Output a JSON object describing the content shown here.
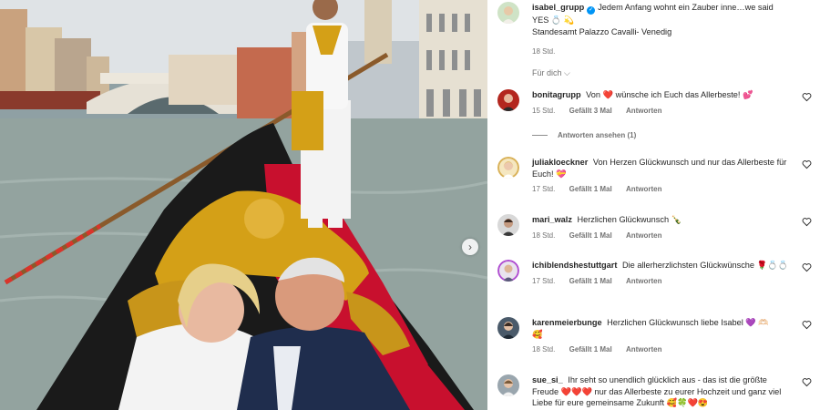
{
  "photo": {
    "alt": "Bride and groom in a gondola on the Grand Canal in Venice"
  },
  "carousel": {
    "next_icon": "chevron-right-icon"
  },
  "caption": {
    "username": "isabel_grupp",
    "verified": true,
    "text_main": "Jedem Anfang wohnt ein Zauber inne…we said YES 💍 💫",
    "text_location": "Standesamt Palazzo Cavalli- Venedig",
    "time": "18 Std."
  },
  "filter": {
    "label": "Für dich",
    "icon": "chevron-down-icon"
  },
  "comments": [
    {
      "username": "bonitagrupp",
      "text_pre": "Von",
      "heart": "❤️",
      "text_post": "wünsche ich Euch das Allerbeste! 💕",
      "time": "15 Std.",
      "likes": "Gefällt 3 Mal",
      "reply": "Antworten",
      "avatar_color": "#b3261e"
    },
    {
      "username": "juliakloeckner",
      "text": "Von Herzen Glückwunsch und nur das Allerbeste für Euch! 💝",
      "time": "17 Std.",
      "likes": "Gefällt 1 Mal",
      "reply": "Antworten",
      "avatar_color": "#d9b25a"
    },
    {
      "username": "mari_walz",
      "text": "Herzlichen Glückwunsch 🍾",
      "time": "18 Std.",
      "likes": "Gefällt 1 Mal",
      "reply": "Antworten",
      "avatar_color": "#6b6b6b"
    },
    {
      "username": "ichiblendshestuttgart",
      "text": "Die allerherzlichsten Glückwünsche 🌹💍💍",
      "time": "17 Std.",
      "likes": "Gefällt 1 Mal",
      "reply": "Antworten",
      "avatar_color": "#9a6fb0"
    },
    {
      "username": "karenmeierbunge",
      "text_pre": "Herzlichen Glückwunsch liebe Isabel 💜 🫶🏻",
      "text_post": "🥰",
      "time": "18 Std.",
      "likes": "Gefällt 1 Mal",
      "reply": "Antworten",
      "avatar_color": "#4a5a6a"
    },
    {
      "username": "sue_si_",
      "text": "Ihr seht so unendlich glücklich aus - das ist die größte Freude ❤️❤️❤️ nur das Allerbeste zu eurer Hochzeit und ganz viel Liebe für eure gemeinsame Zukunft 🥰🍀❤️😍",
      "avatar_color": "#7b8a95"
    }
  ],
  "replies": {
    "label": "Antworten ansehen (1)"
  },
  "like_icon": "heart-outline-icon",
  "colors": {
    "verified": "#0095f6",
    "meta_text": "#737373",
    "text": "#262626"
  }
}
